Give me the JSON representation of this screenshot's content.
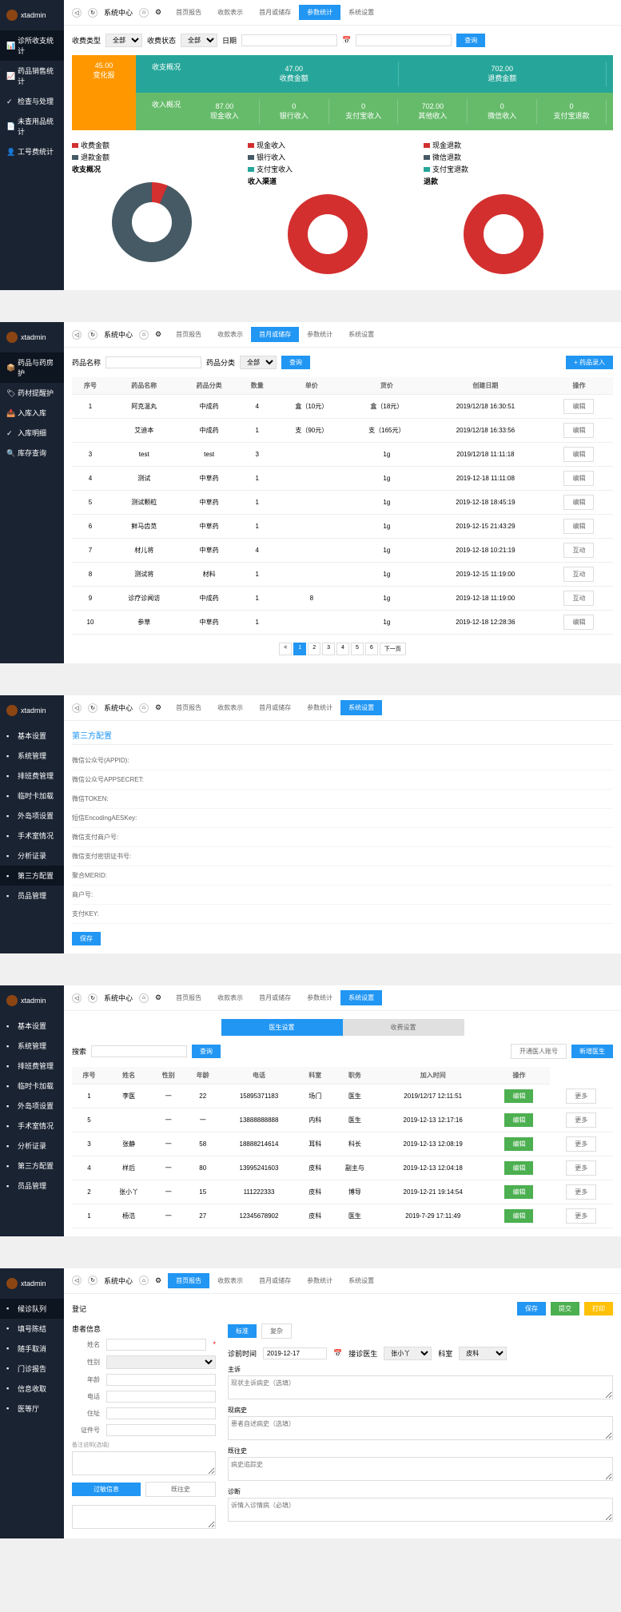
{
  "brand": "xtadmin",
  "topbar": {
    "menu": "系统中心",
    "tabs": [
      "首页报告",
      "收款表示",
      "首月或储存",
      "参数统计",
      "系统设置"
    ]
  },
  "p1": {
    "sidebar": [
      "诊所收支统计",
      "药品销售统计",
      "检查与处理",
      "未查用品统计",
      "工号费统计"
    ],
    "filters": {
      "l1": "收费类型",
      "v1": "全部",
      "l2": "收费状态",
      "v2": "全部",
      "l3": "日期",
      "btn": "查询"
    },
    "stats": {
      "left": [
        "45.00",
        "变化报"
      ],
      "totals": {
        "title": "收支概况",
        "row1": [
          "47.00",
          "702.00"
        ],
        "row1l": [
          "收费金额",
          "退费金额"
        ],
        "row2t": "收入概况",
        "row2": [
          "87.00",
          "0",
          "0",
          "702.00",
          "0",
          "0"
        ],
        "row2l": [
          "现金收入",
          "银行收入",
          "支付宝收入",
          "其他收入",
          "微信收入",
          "支付宝退款"
        ]
      }
    },
    "chart_data": [
      {
        "type": "donut",
        "title": "收支概况",
        "series": [
          {
            "name": "收费金额",
            "value": 47,
            "color": "#d32f2f"
          },
          {
            "name": "退款金额",
            "value": 702,
            "color": "#455a64"
          }
        ]
      },
      {
        "type": "donut",
        "title": "收入渠道",
        "series": [
          {
            "name": "现金收入",
            "value": 87,
            "color": "#d32f2f"
          },
          {
            "name": "银行收入",
            "value": 0,
            "color": "#455a64"
          },
          {
            "name": "支付宝收入",
            "value": 0,
            "color": "#26a69a"
          }
        ]
      },
      {
        "type": "donut",
        "title": "退款",
        "series": [
          {
            "name": "现金退款",
            "value": 702,
            "color": "#d32f2f"
          },
          {
            "name": "微信退款",
            "value": 0,
            "color": "#455a64"
          },
          {
            "name": "支付宝退款",
            "value": 0,
            "color": "#26a69a"
          }
        ]
      }
    ]
  },
  "p2": {
    "sidebar": [
      "药品与药房护",
      "药材提醒护",
      "入库入库",
      "入库明细",
      "库存查询"
    ],
    "search": {
      "l": "药品名称",
      "l2": "药品分类",
      "v2": "全部",
      "btn": "查询",
      "add": "+ 药品录入"
    },
    "headers": [
      "序号",
      "药品名称",
      "药品分类",
      "数量",
      "单价",
      "货价",
      "创建日期",
      "操作"
    ],
    "rows": [
      [
        "1",
        "阿克温丸",
        "中成药",
        "4",
        "盒（10元）",
        "盒（18元）",
        "2019/12/18 16:30:51",
        "编辑"
      ],
      [
        "",
        "艾迪本",
        "中成药",
        "1",
        "支（90元）",
        "支（165元）",
        "2019/12/18 16:33:56",
        "编辑"
      ],
      [
        "3",
        "test",
        "test",
        "3",
        "",
        "1g",
        "2019/12/18 11:11:18",
        "编辑"
      ],
      [
        "4",
        "测试",
        "中草药",
        "1",
        "",
        "1g",
        "2019-12-18 11:11:08",
        "编辑"
      ],
      [
        "5",
        "测试颗粒",
        "中草药",
        "1",
        "",
        "1g",
        "2019-12-18 18:45:19",
        "编辑"
      ],
      [
        "6",
        "鲜马齿苋",
        "中草药",
        "1",
        "",
        "1g",
        "2019-12-15 21:43:29",
        "编辑"
      ],
      [
        "7",
        "材儿将",
        "中草药",
        "4",
        "",
        "1g",
        "2019-12-18 10:21:19",
        "互动"
      ],
      [
        "8",
        "测试将",
        "材料",
        "1",
        "",
        "1g",
        "2019-12-15 11:19:00",
        "互动"
      ],
      [
        "9",
        "诊疗诊闻访",
        "中成药",
        "1",
        "8",
        "1g",
        "2019-12-18 11:19:00",
        "互动"
      ],
      [
        "10",
        "参草",
        "中草药",
        "1",
        "",
        "1g",
        "2019-12-18 12:28:36",
        "编辑"
      ]
    ],
    "pages": [
      "<",
      "1",
      "2",
      "3",
      "4",
      "5",
      "6",
      "下一页"
    ]
  },
  "p3": {
    "sidebar": [
      "基本设置",
      "系统管理",
      "排班费管理",
      "临时卡加载",
      "外岛项设置",
      "手术室情况",
      "分析证录",
      "第三方配置",
      "员品管理"
    ],
    "title": "第三方配置",
    "save": "保存",
    "items": [
      "微信公众号(APPID):",
      "微信公众号APPSECRET:",
      "微信TOKEN:",
      "短信EncodingAESKey:",
      "微信支付商户号:",
      "微信支付密钥证书号:",
      "聚合MERID:",
      "商户号:",
      "支付KEY:"
    ]
  },
  "p4": {
    "sidebar": [
      "基本设置",
      "系统管理",
      "排班费管理",
      "临时卡加载",
      "外岛项设置",
      "手术室情况",
      "分析证录",
      "第三方配置",
      "员品管理"
    ],
    "pills": [
      "医生设置",
      "收费设置"
    ],
    "search": {
      "l": "搜索",
      "btn": "查询",
      "b1": "开通医人账号",
      "b2": "新增医生"
    },
    "headers": [
      "序号",
      "姓名",
      "性别",
      "年龄",
      "电话",
      "科室",
      "职务",
      "加入时间",
      "操作"
    ],
    "rows": [
      [
        "1",
        "李医",
        "一",
        "22",
        "15895371183",
        "场门",
        "医生",
        "2019/12/17 12:11:51",
        "编辑",
        "更多"
      ],
      [
        "5",
        "",
        "一",
        "一",
        "13888888888",
        "内科",
        "医生",
        "2019-12-13 12:17:16",
        "编辑",
        "更多"
      ],
      [
        "3",
        "张静",
        "一",
        "58",
        "18888214614",
        "耳科",
        "科长",
        "2019-12-13 12:08:19",
        "编辑",
        "更多"
      ],
      [
        "4",
        "样后",
        "一",
        "80",
        "13995241603",
        "皮科",
        "副主与",
        "2019-12-13 12:04:18",
        "编辑",
        "更多"
      ],
      [
        "2",
        "张小丫",
        "一",
        "15",
        "111222333",
        "皮科",
        "博导",
        "2019-12-21 19:14:54",
        "编辑",
        "更多"
      ],
      [
        "1",
        "杨浩",
        "一",
        "27",
        "12345678902",
        "皮科",
        "医生",
        "2019-7-29 17:11:49",
        "编辑",
        "更多"
      ]
    ]
  },
  "p5": {
    "sidebar": [
      "候诊队列",
      "填号陈结",
      "随手取消",
      "门诊报告",
      "信息收取",
      "医等厅"
    ],
    "title": "登记",
    "btns": [
      "保存",
      "提交",
      "打印"
    ],
    "patient": {
      "title": "患者信息",
      "fields": {
        "name": "姓名",
        "sex": "性别",
        "age": "年龄",
        "phone": "电话",
        "addr": "住址",
        "idcard": "证件号",
        "note": "备注说明(选填)",
        "history": "既往史"
      }
    },
    "record": {
      "pills": [
        "标准",
        "复杂"
      ],
      "l1": "诊前时间",
      "v1": "2019-12-17",
      "l2": "接诊医生",
      "v2": "张小丫",
      "l3": "科室",
      "v3": "皮科",
      "sections": [
        "主诉",
        "现状主诉病史（选填）",
        "现病史",
        "患者自述病史（选填）",
        "既往史",
        "病史追踪史",
        "诊断",
        "诉情入诊情病（必填）"
      ]
    }
  }
}
